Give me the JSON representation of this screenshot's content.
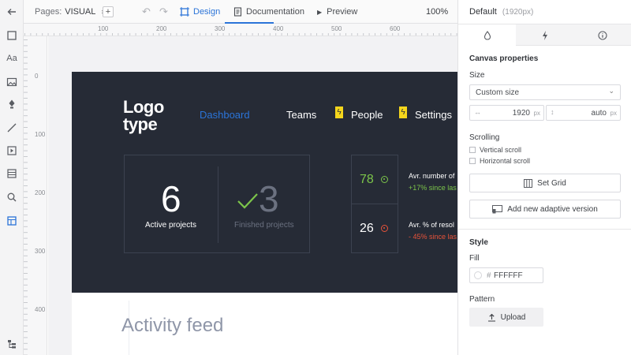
{
  "toolbar": {
    "back_icon": "arrow-left-icon",
    "tools": [
      "square-icon",
      "text-icon",
      "image-icon",
      "pen-icon",
      "line-icon",
      "component-icon",
      "table-icon",
      "search-icon",
      "layout-icon"
    ],
    "text_tool_label": "Aa",
    "layers_icon": "layers-icon"
  },
  "topbar": {
    "pages_label": "Pages:",
    "pages_value": "VISUAL",
    "undo_icon": "undo-icon",
    "redo_icon": "redo-icon",
    "tabs": [
      {
        "label": "Design",
        "active": true
      },
      {
        "label": "Documentation",
        "active": false
      },
      {
        "label": "Preview",
        "active": false
      }
    ],
    "zoom": "100%"
  },
  "rulers": {
    "h": [
      "100",
      "200",
      "300",
      "400",
      "500",
      "600"
    ],
    "v": [
      "0",
      "100",
      "200",
      "300",
      "400"
    ]
  },
  "artboard": {
    "logo_line1": "Logo",
    "logo_line2": "type",
    "nav": [
      {
        "label": "Dashboard",
        "active": true
      },
      {
        "label": "Teams",
        "active": false
      },
      {
        "label": "People",
        "active": false
      },
      {
        "label": "Settings",
        "active": false
      }
    ],
    "stats": [
      {
        "value": "6",
        "label": "Active projects"
      },
      {
        "value": "3",
        "label": "Finished projects"
      }
    ],
    "metrics": [
      {
        "value": "78",
        "text": "Avr. number of",
        "change": "+17% since las",
        "color": "#7cc54a"
      },
      {
        "value": "26",
        "text": "Avr. % of resol",
        "change": "- 45% since las",
        "color": "#e8533a"
      }
    ],
    "activity_title": "Activity feed"
  },
  "panel": {
    "breakpoint": "Default",
    "breakpoint_width": "(1920px)",
    "tabs": [
      "drop-icon",
      "bolt-icon",
      "info-icon"
    ],
    "canvas_title": "Canvas properties",
    "size_label": "Size",
    "size_value": "Custom size",
    "width_value": "1920",
    "width_unit": "px",
    "height_value": "auto",
    "height_unit": "px",
    "scrolling_label": "Scrolling",
    "vertical_scroll": "Vertical scroll",
    "horizontal_scroll": "Horizontal scroll",
    "set_grid": "Set Grid",
    "add_adaptive": "Add new adaptive version",
    "style_title": "Style",
    "fill_label": "Fill",
    "fill_hash": "#",
    "fill_value": "FFFFFF",
    "pattern_label": "Pattern",
    "upload": "Upload"
  },
  "colors": {
    "accent": "#2b74d8",
    "dark_bg": "#262b36",
    "bolt": "#f5d61c",
    "green": "#7cc54a",
    "red": "#e8533a"
  }
}
